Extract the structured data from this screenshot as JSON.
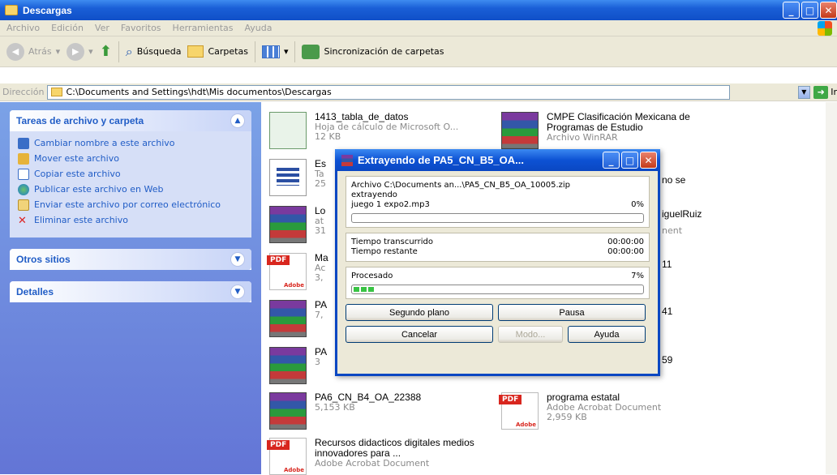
{
  "window": {
    "title": "Descargas"
  },
  "menu": [
    "Archivo",
    "Edición",
    "Ver",
    "Favoritos",
    "Herramientas",
    "Ayuda"
  ],
  "toolbar": {
    "back": "Atrás",
    "search": "Búsqueda",
    "folders": "Carpetas",
    "sync": "Sincronización de carpetas"
  },
  "address": {
    "label": "Dirección",
    "value": "C:\\Documents and Settings\\hdt\\Mis documentos\\Descargas",
    "go": "Ir"
  },
  "tasks": {
    "title": "Tareas de archivo y carpeta",
    "items": [
      "Cambiar nombre a este archivo",
      "Mover este archivo",
      "Copiar este archivo",
      "Publicar este archivo en Web",
      "Enviar este archivo por correo electrónico",
      "Eliminar este archivo"
    ]
  },
  "other_places": {
    "title": "Otros sitios"
  },
  "details": {
    "title": "Detalles"
  },
  "files": [
    {
      "name": "1413_tabla_de_datos",
      "type": "Hoja de cálculo de Microsoft O...",
      "size": "12 KB",
      "icon": "excel-icon"
    },
    {
      "name": "CMPE Clasificación Mexicana de Programas de Estudio",
      "type": "Archivo WinRAR",
      "size": "",
      "icon": "winrar-icon"
    },
    {
      "name": "Es",
      "type": "Ta",
      "size": "25",
      "icon": "table-doc-icon"
    },
    {
      "name": "no se",
      "type": "",
      "size": "",
      "icon": ""
    },
    {
      "name": "Lo",
      "type": "at",
      "size": "31",
      "icon": "winrar-icon"
    },
    {
      "name": "iguelRuiz",
      "type": "nent",
      "size": "",
      "icon": ""
    },
    {
      "name": "Ma",
      "type": "Ac",
      "size": "3,",
      "icon": "pdf-icon"
    },
    {
      "name": "11",
      "type": "",
      "size": "",
      "icon": ""
    },
    {
      "name": "PA",
      "type": "7,",
      "size": "",
      "icon": "winrar-icon"
    },
    {
      "name": "41",
      "type": "",
      "size": "",
      "icon": ""
    },
    {
      "name": "PA",
      "type": "3",
      "size": "",
      "icon": "winrar-icon"
    },
    {
      "name": "59",
      "type": "",
      "size": "",
      "icon": ""
    },
    {
      "name": "PA6_CN_B4_OA_22388",
      "type": "",
      "size": "5,153 KB",
      "icon": "winrar-icon"
    },
    {
      "name": "programa estatal",
      "type": "Adobe Acrobat Document",
      "size": "2,959 KB",
      "icon": "pdf-icon"
    },
    {
      "name": "Recursos didacticos digitales medios innovadores para ...",
      "type": "Adobe Acrobat Document",
      "size": "",
      "icon": "pdf-icon"
    }
  ],
  "dialog": {
    "title": "Extrayendo de PA5_CN_B5_OA...",
    "archive_line": "Archivo C:\\Documents an...\\PA5_CN_B5_OA_10005.zip",
    "action": "extrayendo",
    "current_file": "juego 1 expo2.mp3",
    "current_pct": "0%",
    "current_progress": 0.0,
    "elapsed_label": "Tiempo transcurrido",
    "elapsed": "00:00:00",
    "remaining_label": "Tiempo restante",
    "remaining": "00:00:00",
    "processed_label": "Procesado",
    "processed_pct": "7%",
    "processed_progress": 0.07,
    "buttons": {
      "background": "Segundo plano",
      "pause": "Pausa",
      "cancel": "Cancelar",
      "mode": "Modo...",
      "help": "Ayuda"
    }
  }
}
